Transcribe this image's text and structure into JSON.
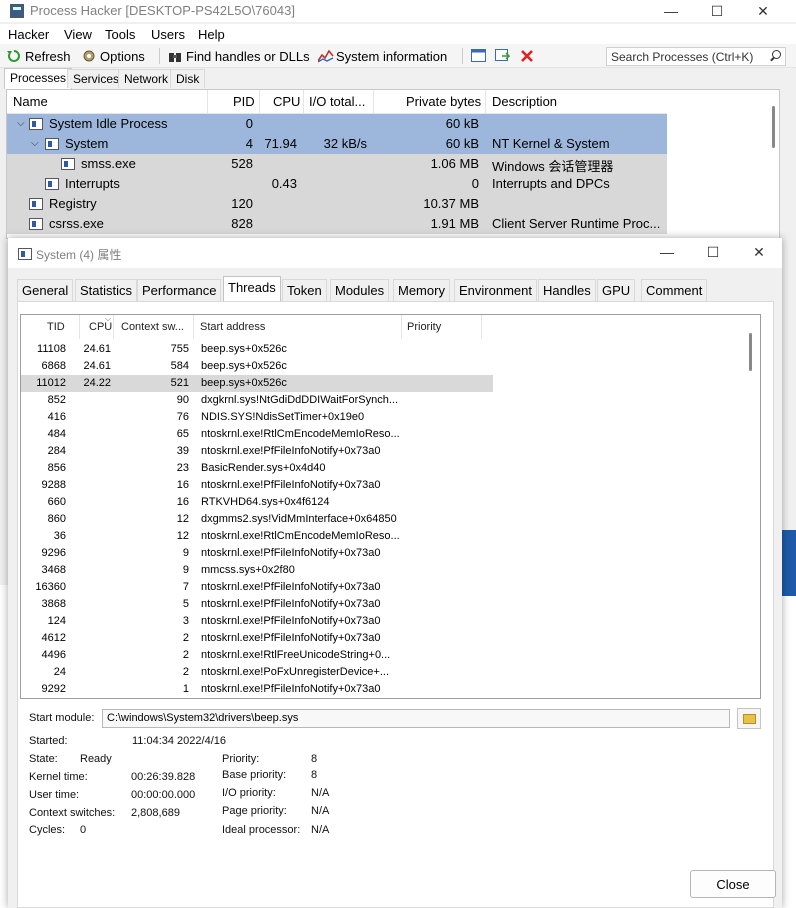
{
  "main_window": {
    "title": "Process Hacker [DESKTOP-PS42L5O\\76043]",
    "menu": [
      "Hacker",
      "View",
      "Tools",
      "Users",
      "Help"
    ],
    "toolbar": {
      "refresh": "Refresh",
      "options": "Options",
      "find_handles": "Find handles or DLLs",
      "system_info": "System information",
      "search_placeholder": "Search Processes (Ctrl+K)"
    },
    "tabs": [
      "Processes",
      "Services",
      "Network",
      "Disk"
    ],
    "columns": [
      "Name",
      "PID",
      "CPU",
      "I/O total...",
      "Private bytes",
      "Description"
    ],
    "rows": [
      {
        "name": "System Idle Process",
        "pid": "0",
        "cpu": "",
        "io": "",
        "priv": "60 kB",
        "desc": ""
      },
      {
        "name": "System",
        "pid": "4",
        "cpu": "71.94",
        "io": "32 kB/s",
        "priv": "60 kB",
        "desc": "NT Kernel & System"
      },
      {
        "name": "smss.exe",
        "pid": "528",
        "cpu": "",
        "io": "",
        "priv": "1.06 MB",
        "desc": "Windows 会话管理器"
      },
      {
        "name": "Interrupts",
        "pid": "",
        "cpu": "0.43",
        "io": "",
        "priv": "0",
        "desc": "Interrupts and DPCs"
      },
      {
        "name": "Registry",
        "pid": "120",
        "cpu": "",
        "io": "",
        "priv": "10.37 MB",
        "desc": ""
      },
      {
        "name": "csrss.exe",
        "pid": "828",
        "cpu": "",
        "io": "",
        "priv": "1.91 MB",
        "desc": "Client Server Runtime Proc..."
      }
    ]
  },
  "dialog": {
    "title": "System (4) 属性",
    "tabs": [
      "General",
      "Statistics",
      "Performance",
      "Threads",
      "Token",
      "Modules",
      "Memory",
      "Environment",
      "Handles",
      "GPU",
      "Comment"
    ],
    "active_tab": "Threads",
    "thread_columns": [
      "TID",
      "CPU",
      "Context sw...",
      "Start address",
      "Priority"
    ],
    "threads": [
      {
        "tid": "11108",
        "cpu": "24.61",
        "ctx": "755",
        "addr": "beep.sys+0x526c"
      },
      {
        "tid": "6868",
        "cpu": "24.61",
        "ctx": "584",
        "addr": "beep.sys+0x526c"
      },
      {
        "tid": "11012",
        "cpu": "24.22",
        "ctx": "521",
        "addr": "beep.sys+0x526c"
      },
      {
        "tid": "852",
        "cpu": "",
        "ctx": "90",
        "addr": "dxgkrnl.sys!NtGdiDdDDIWaitForSynch..."
      },
      {
        "tid": "416",
        "cpu": "",
        "ctx": "76",
        "addr": "NDIS.SYS!NdisSetTimer+0x19e0"
      },
      {
        "tid": "484",
        "cpu": "",
        "ctx": "65",
        "addr": "ntoskrnl.exe!RtlCmEncodeMemIoReso..."
      },
      {
        "tid": "284",
        "cpu": "",
        "ctx": "39",
        "addr": "ntoskrnl.exe!PfFileInfoNotify+0x73a0"
      },
      {
        "tid": "856",
        "cpu": "",
        "ctx": "23",
        "addr": "BasicRender.sys+0x4d40"
      },
      {
        "tid": "9288",
        "cpu": "",
        "ctx": "16",
        "addr": "ntoskrnl.exe!PfFileInfoNotify+0x73a0"
      },
      {
        "tid": "660",
        "cpu": "",
        "ctx": "16",
        "addr": "RTKVHD64.sys+0x4f6124"
      },
      {
        "tid": "860",
        "cpu": "",
        "ctx": "12",
        "addr": "dxgmms2.sys!VidMmInterface+0x64850"
      },
      {
        "tid": "36",
        "cpu": "",
        "ctx": "12",
        "addr": "ntoskrnl.exe!RtlCmEncodeMemIoReso..."
      },
      {
        "tid": "9296",
        "cpu": "",
        "ctx": "9",
        "addr": "ntoskrnl.exe!PfFileInfoNotify+0x73a0"
      },
      {
        "tid": "3468",
        "cpu": "",
        "ctx": "9",
        "addr": "mmcss.sys+0x2f80"
      },
      {
        "tid": "16360",
        "cpu": "",
        "ctx": "7",
        "addr": "ntoskrnl.exe!PfFileInfoNotify+0x73a0"
      },
      {
        "tid": "3868",
        "cpu": "",
        "ctx": "5",
        "addr": "ntoskrnl.exe!PfFileInfoNotify+0x73a0"
      },
      {
        "tid": "124",
        "cpu": "",
        "ctx": "3",
        "addr": "ntoskrnl.exe!PfFileInfoNotify+0x73a0"
      },
      {
        "tid": "4612",
        "cpu": "",
        "ctx": "2",
        "addr": "ntoskrnl.exe!PfFileInfoNotify+0x73a0"
      },
      {
        "tid": "4496",
        "cpu": "",
        "ctx": "2",
        "addr": "ntoskrnl.exe!RtlFreeUnicodeString+0..."
      },
      {
        "tid": "24",
        "cpu": "",
        "ctx": "2",
        "addr": "ntoskrnl.exe!PoFxUnregisterDevice+..."
      },
      {
        "tid": "9292",
        "cpu": "",
        "ctx": "1",
        "addr": "ntoskrnl.exe!PfFileInfoNotify+0x73a0"
      }
    ],
    "start_module_label": "Start module:",
    "start_module_value": "C:\\windows\\System32\\drivers\\beep.sys",
    "details": {
      "started_label": "Started:",
      "started_value": "11:04:34 2022/4/16",
      "state_label": "State:",
      "state_value": "Ready",
      "kernel_label": "Kernel time:",
      "kernel_value": "00:26:39.828",
      "user_label": "User time:",
      "user_value": "00:00:00.000",
      "ctx_label": "Context switches:",
      "ctx_value": "2,808,689",
      "cycles_label": "Cycles:",
      "cycles_value": "0",
      "priority_label": "Priority:",
      "priority_value": "8",
      "base_label": "Base priority:",
      "base_value": "8",
      "io_label": "I/O priority:",
      "io_value": "N/A",
      "page_label": "Page priority:",
      "page_value": "N/A",
      "ideal_label": "Ideal processor:",
      "ideal_value": "N/A"
    },
    "close_label": "Close"
  },
  "colors": {
    "selection": "#9db6db",
    "row_gray": "#d8d8d8",
    "close_x": "#e02020",
    "refresh_green": "#2f9a2f"
  }
}
